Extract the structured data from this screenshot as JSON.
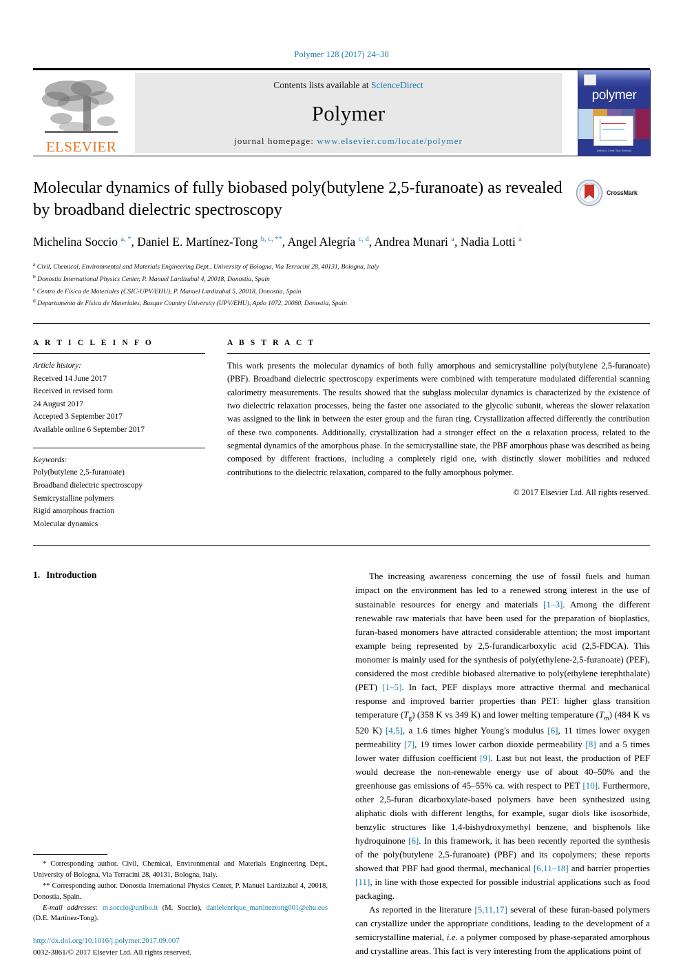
{
  "running_head": "Polymer 128 (2017) 24–30",
  "masthead": {
    "publisher_logo_text": "ELSEVIER",
    "contents_prefix": "Contents lists available at ",
    "contents_link": "ScienceDirect",
    "journal_name": "Polymer",
    "homepage_prefix": "journal homepage: ",
    "homepage_url": "www.elsevier.com/locate/polymer",
    "cover_title": "polymer",
    "cover_footer": "Editor-in-Chief: Bob Sheldon"
  },
  "article": {
    "title": "Molecular dynamics of fully biobased poly(butylene 2,5-furanoate) as revealed by broadband dielectric spectroscopy",
    "crossmark_label": "CrossMark",
    "authors_html": "Michelina Soccio <sup>a, *</sup>, Daniel E. Martínez-Tong <sup>b, c, **</sup>, Angel Alegría <sup>c, d</sup>, Andrea Munari <sup>a</sup>, Nadia Lotti <sup>a</sup>",
    "affiliations": [
      {
        "marker": "a",
        "text": "Civil, Chemical, Environmental and Materials Engineering Dept., University of Bologna, Via Terracini 28, 40131, Bologna, Italy"
      },
      {
        "marker": "b",
        "text": "Donostia International Physics Center, P. Manuel Lardizabal 4, 20018, Donostia, Spain"
      },
      {
        "marker": "c",
        "text": "Centro de Física de Materiales (CSIC-UPV/EHU), P. Manuel Lardizabal 5, 20018, Donostia, Spain"
      },
      {
        "marker": "d",
        "text": "Departamento de Física de Materiales, Basque Country University (UPV/EHU), Apdo 1072, 20080, Donostia, Spain"
      }
    ]
  },
  "article_info": {
    "heading": "A R T I C L E  I N F O",
    "history_label": "Article history:",
    "history": [
      "Received 14 June 2017",
      "Received in revised form",
      "24 August 2017",
      "Accepted 3 September 2017",
      "Available online 6 September 2017"
    ],
    "keywords_label": "Keywords:",
    "keywords": [
      "Poly(butylene 2,5-furanoate)",
      "Broadband dielectric spectroscopy",
      "Semicrystalline polymers",
      "Rigid amorphous fraction",
      "Molecular dynamics"
    ]
  },
  "abstract": {
    "heading": "A B S T R A C T",
    "text": "This work presents the molecular dynamics of both fully amorphous and semicrystalline poly(butylene 2,5-furanoate) (PBF). Broadband dielectric spectroscopy experiments were combined with temperature modulated differential scanning calorimetry measurements. The results showed that the subglass molecular dynamics is characterized by the existence of two dielectric relaxation processes, being the faster one associated to the glycolic subunit, whereas the slower relaxation was assigned to the link in between the ester group and the furan ring. Crystallization affected differently the contribution of these two components. Additionally, crystallization had a stronger effect on the α relaxation process, related to the segmental dynamics of the amorphous phase. In the semicrystalline state, the PBF amorphous phase was described as being composed by different fractions, including a completely rigid one, with distinctly slower mobilities and reduced contributions to the dielectric relaxation, compared to the fully amorphous polymer.",
    "copyright": "© 2017 Elsevier Ltd. All rights reserved."
  },
  "introduction": {
    "number": "1.",
    "heading": "Introduction",
    "paragraph_1_html": "The increasing awareness concerning the use of fossil fuels and human impact on the environment has led to a renewed strong interest in the use of sustainable resources for energy and materials <span class=\"link\">[1–3]</span>. Among the different renewable raw materials that have been used for the preparation of bioplastics, furan-based monomers have attracted considerable attention; the most important example being represented by 2,5-furandicarboxylic acid (2,5-FDCA). This monomer is mainly used for the synthesis of poly(ethylene-2,5-furanoate) (PEF), considered the most credible biobased alternative to poly(ethylene terephthalate) (PET) <span class=\"link\">[1–5]</span>. In fact, PEF displays more attractive thermal and mechanical response and improved barrier properties than PET: higher glass transition temperature (<i>T</i><sub>g</sub>) (358 K vs 349 K) and lower melting temperature (<i>T</i><sub>m</sub>) (484 K vs 520 K) <span class=\"link\">[4,5]</span>, a 1.6 times higher Young's modulus <span class=\"link\">[6]</span>, 11 times lower oxygen permeability <span class=\"link\">[7]</span>, 19 times lower carbon dioxide permeability <span class=\"link\">[8]</span> and a 5 times lower water diffusion coefficient <span class=\"link\">[9]</span>. Last but not least, the production of PEF would decrease the non-renewable energy use of about 40–50% and the greenhouse gas emissions of 45–55% ca. with respect to PET <span class=\"link\">[10]</span>. Furthermore, other 2,5-furan dicarboxylate-based polymers have been synthesized using aliphatic diols with different lengths, for example, sugar diols like isosorbide, benzylic structures like 1,4-bishydroxymethyl benzene, and bisphenols like hydroquinone <span class=\"link\">[6]</span>. In this framework, it has been recently reported the synthesis of the poly(butylene 2,5-furanoate) (PBF) and its copolymers; these reports showed that PBF had good thermal, mechanical <span class=\"link\">[6,11–18]</span> and barrier properties <span class=\"link\">[11]</span>, in line with those expected for possible industrial applications such as food packaging.",
    "paragraph_2_html": "As reported in the literature <span class=\"link\">[5,11,17]</span> several of these furan-based polymers can crystallize under the appropriate conditions, leading to the development of a semicrystalline material, <i>i.e.</i> a polymer composed by phase-separated amorphous and crystalline areas. This fact is very interesting from the applications point of"
  },
  "footnotes": {
    "note_1_html": "<span>*</span> Corresponding author. Civil, Chemical, Environmental and Materials Engineering Dept., University of Bologna, Via Terracini 28, 40131, Bologna, Italy.",
    "note_2_html": "<span>**</span> Corresponding author. Donostia International Physics Center, P. Manuel Lardizabal 4, 20018, Donostia, Spain.",
    "note_3_html": "<span class=\"em\">E-mail addresses:</span> <span class=\"link\">m.soccio@unibo.it</span> (M. Soccio), <span class=\"link\">danielenrique_martineztong001@ehu.eus</span> (D.E. Martínez-Tong).",
    "doi": "http://dx.doi.org/10.1016/j.polymer.2017.09.007",
    "issn_line": "0032-3861/© 2017 Elsevier Ltd. All rights reserved."
  },
  "colors": {
    "link": "#1a7aa8",
    "elsevier_orange": "#E87722",
    "cover_blue": "#2b3a8f"
  }
}
